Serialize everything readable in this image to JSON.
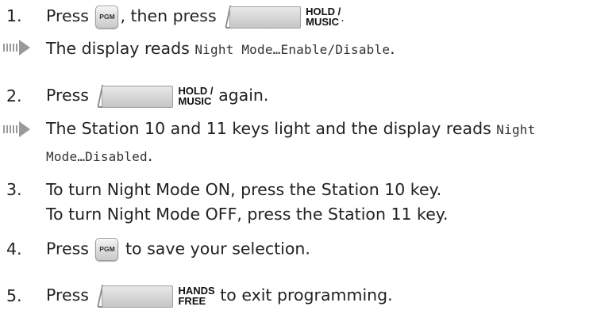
{
  "steps": [
    {
      "number": "1.",
      "press": "Press",
      "pgm_label": "PGM",
      "mid": ", then press",
      "key_line1": "HOLD /",
      "key_line2": "MUSIC",
      "end": ".",
      "result_prefix": "The display reads",
      "result_mono": "Night Mode…Enable/Disable",
      "result_end": "."
    },
    {
      "number": "2.",
      "press": "Press",
      "key_line1": "HOLD /",
      "key_line2": "MUSIC",
      "end": "again.",
      "result_prefix": "The Station 10 and 11 keys light and the display reads",
      "result_mono_a": "Night",
      "result_mono_b": "Mode…Disabled",
      "result_end": "."
    },
    {
      "number": "3.",
      "line1": "To turn Night Mode ON, press the Station 10 key.",
      "line2": "To turn Night Mode OFF, press the Station 11 key."
    },
    {
      "number": "4.",
      "press": "Press",
      "pgm_label": "PGM",
      "end": "to save your selection."
    },
    {
      "number": "5.",
      "press": "Press",
      "key_line1": "HANDS",
      "key_line2": "FREE",
      "end": "to exit programming."
    }
  ]
}
